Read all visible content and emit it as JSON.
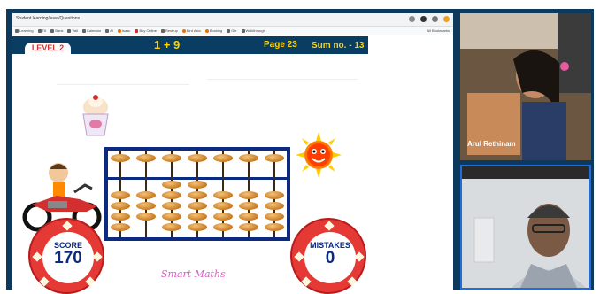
{
  "browser": {
    "url": "Student learning/level/Questions",
    "bookmarks": [
      "Learning",
      "ТК",
      "Bank",
      "Vall",
      "Calendar",
      "AI",
      "Isaac",
      "Buy Online",
      "Rest up",
      "Bird Asto",
      "Booking",
      "Gle",
      "Walkthrough",
      "All Bookmarks"
    ]
  },
  "game": {
    "level": "LEVEL 2",
    "sum_equation": "1 + 9",
    "page": "Page 23",
    "sum_number": "Sum no. - 13",
    "score_label": "SCORE",
    "score_value": "170",
    "mistakes_label": "MISTAKES",
    "mistakes_value": "0",
    "brand": "Smart Maths"
  },
  "participants": [
    {
      "name": "Arul Rethinam"
    }
  ],
  "colors": {
    "navy": "#0a3d62",
    "yellow_text": "#ffd400",
    "red_ring": "#e53935",
    "abacus_frame": "#0b2a80",
    "bead": "#d98a2b",
    "active_speaker_border": "#1e6fd9"
  }
}
